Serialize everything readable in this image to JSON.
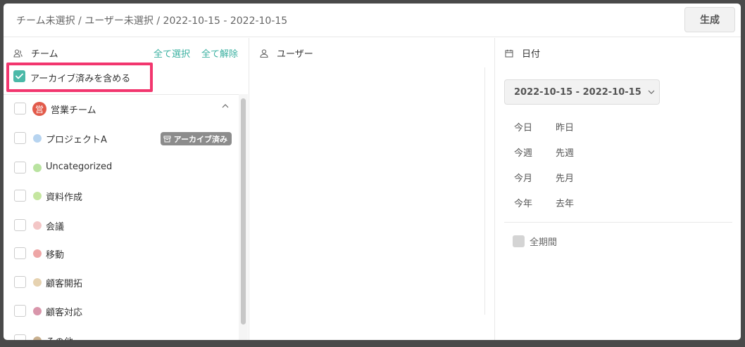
{
  "header": {
    "breadcrumb": "チーム未選択 / ユーザー未選択 / 2022-10-15 - 2022-10-15",
    "generate_label": "生成"
  },
  "team_panel": {
    "title": "チーム",
    "select_all": "全て選択",
    "deselect_all": "全て解除",
    "include_archived_label": "アーカイブ済みを含める",
    "include_archived_checked": true,
    "team": {
      "logo_char": "営",
      "name": "営業チーム",
      "expanded": true
    },
    "archived_badge": "アーカイブ済み",
    "projects": [
      {
        "name": "プロジェクトA",
        "color": "#b7d4f0",
        "archived": true
      },
      {
        "name": "Uncategorized",
        "color": "#b9e3a0"
      },
      {
        "name": "資料作成",
        "color": "#c5e6a0"
      },
      {
        "name": "会議",
        "color": "#f3c6c6"
      },
      {
        "name": "移動",
        "color": "#eea6a6"
      },
      {
        "name": "顧客開拓",
        "color": "#e6d2b0"
      },
      {
        "name": "顧客対応",
        "color": "#d996ab"
      },
      {
        "name": "その他",
        "color": "#c9b08f"
      }
    ]
  },
  "user_panel": {
    "title": "ユーザー"
  },
  "date_panel": {
    "title": "日付",
    "range_label": "2022-10-15 - 2022-10-15",
    "quick": {
      "today": "今日",
      "yesterday": "昨日",
      "this_week": "今週",
      "last_week": "先週",
      "this_month": "今月",
      "last_month": "先月",
      "this_year": "今年",
      "last_year": "去年"
    },
    "all_period_label": "全期間"
  },
  "colors": {
    "accent": "#3ab0a0",
    "checkbox_checked": "#4bb9a8",
    "highlight": "#f2366e"
  }
}
